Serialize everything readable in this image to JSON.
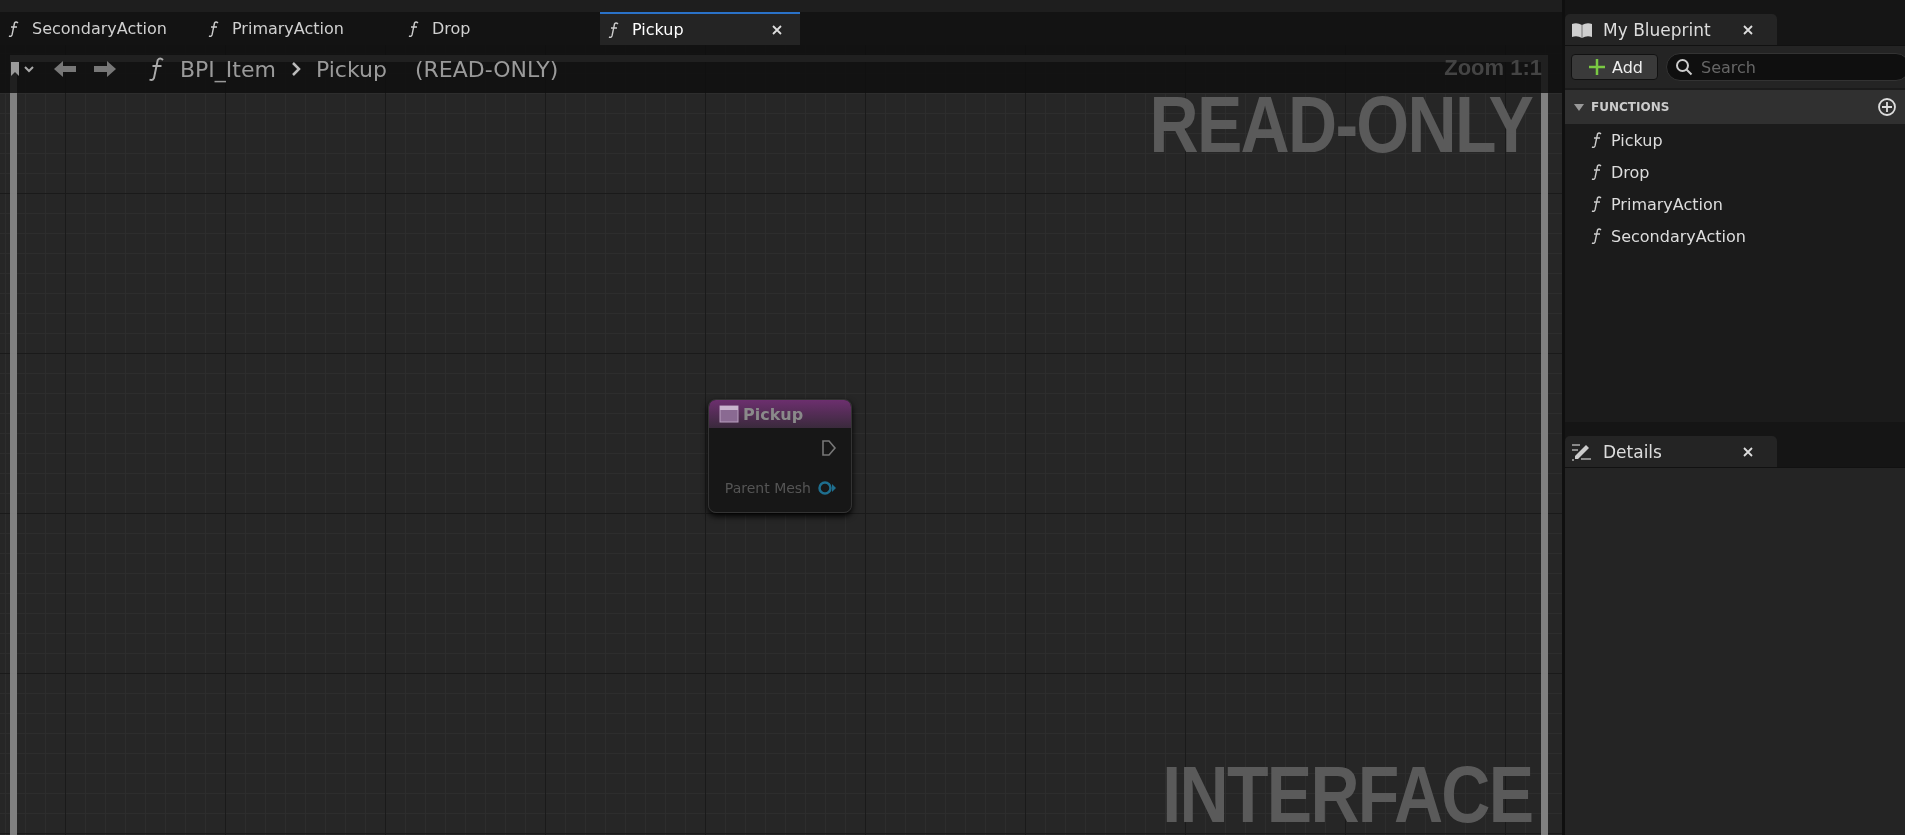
{
  "tabs": [
    {
      "label": "SecondaryAction",
      "selected": false
    },
    {
      "label": "PrimaryAction",
      "selected": false
    },
    {
      "label": "Drop",
      "selected": false
    },
    {
      "label": "Pickup",
      "selected": true
    }
  ],
  "breadcrumb": {
    "parent": "BPI_Item",
    "current": "Pickup",
    "suffix": "(READ-ONLY)"
  },
  "graph": {
    "zoom": "Zoom 1:1",
    "watermark_top": "READ-ONLY",
    "watermark_bottom": "INTERFACE",
    "node": {
      "title": "Pickup",
      "pins": [
        {
          "kind": "exec"
        },
        {
          "kind": "object",
          "label": "Parent Mesh"
        }
      ]
    }
  },
  "my_blueprint": {
    "title": "My Blueprint",
    "add_label": "Add",
    "search_placeholder": "Search",
    "sections": [
      {
        "title": "FUNCTIONS",
        "expanded": true,
        "items": [
          "Pickup",
          "Drop",
          "PrimaryAction",
          "SecondaryAction"
        ]
      }
    ]
  },
  "details": {
    "title": "Details"
  }
}
